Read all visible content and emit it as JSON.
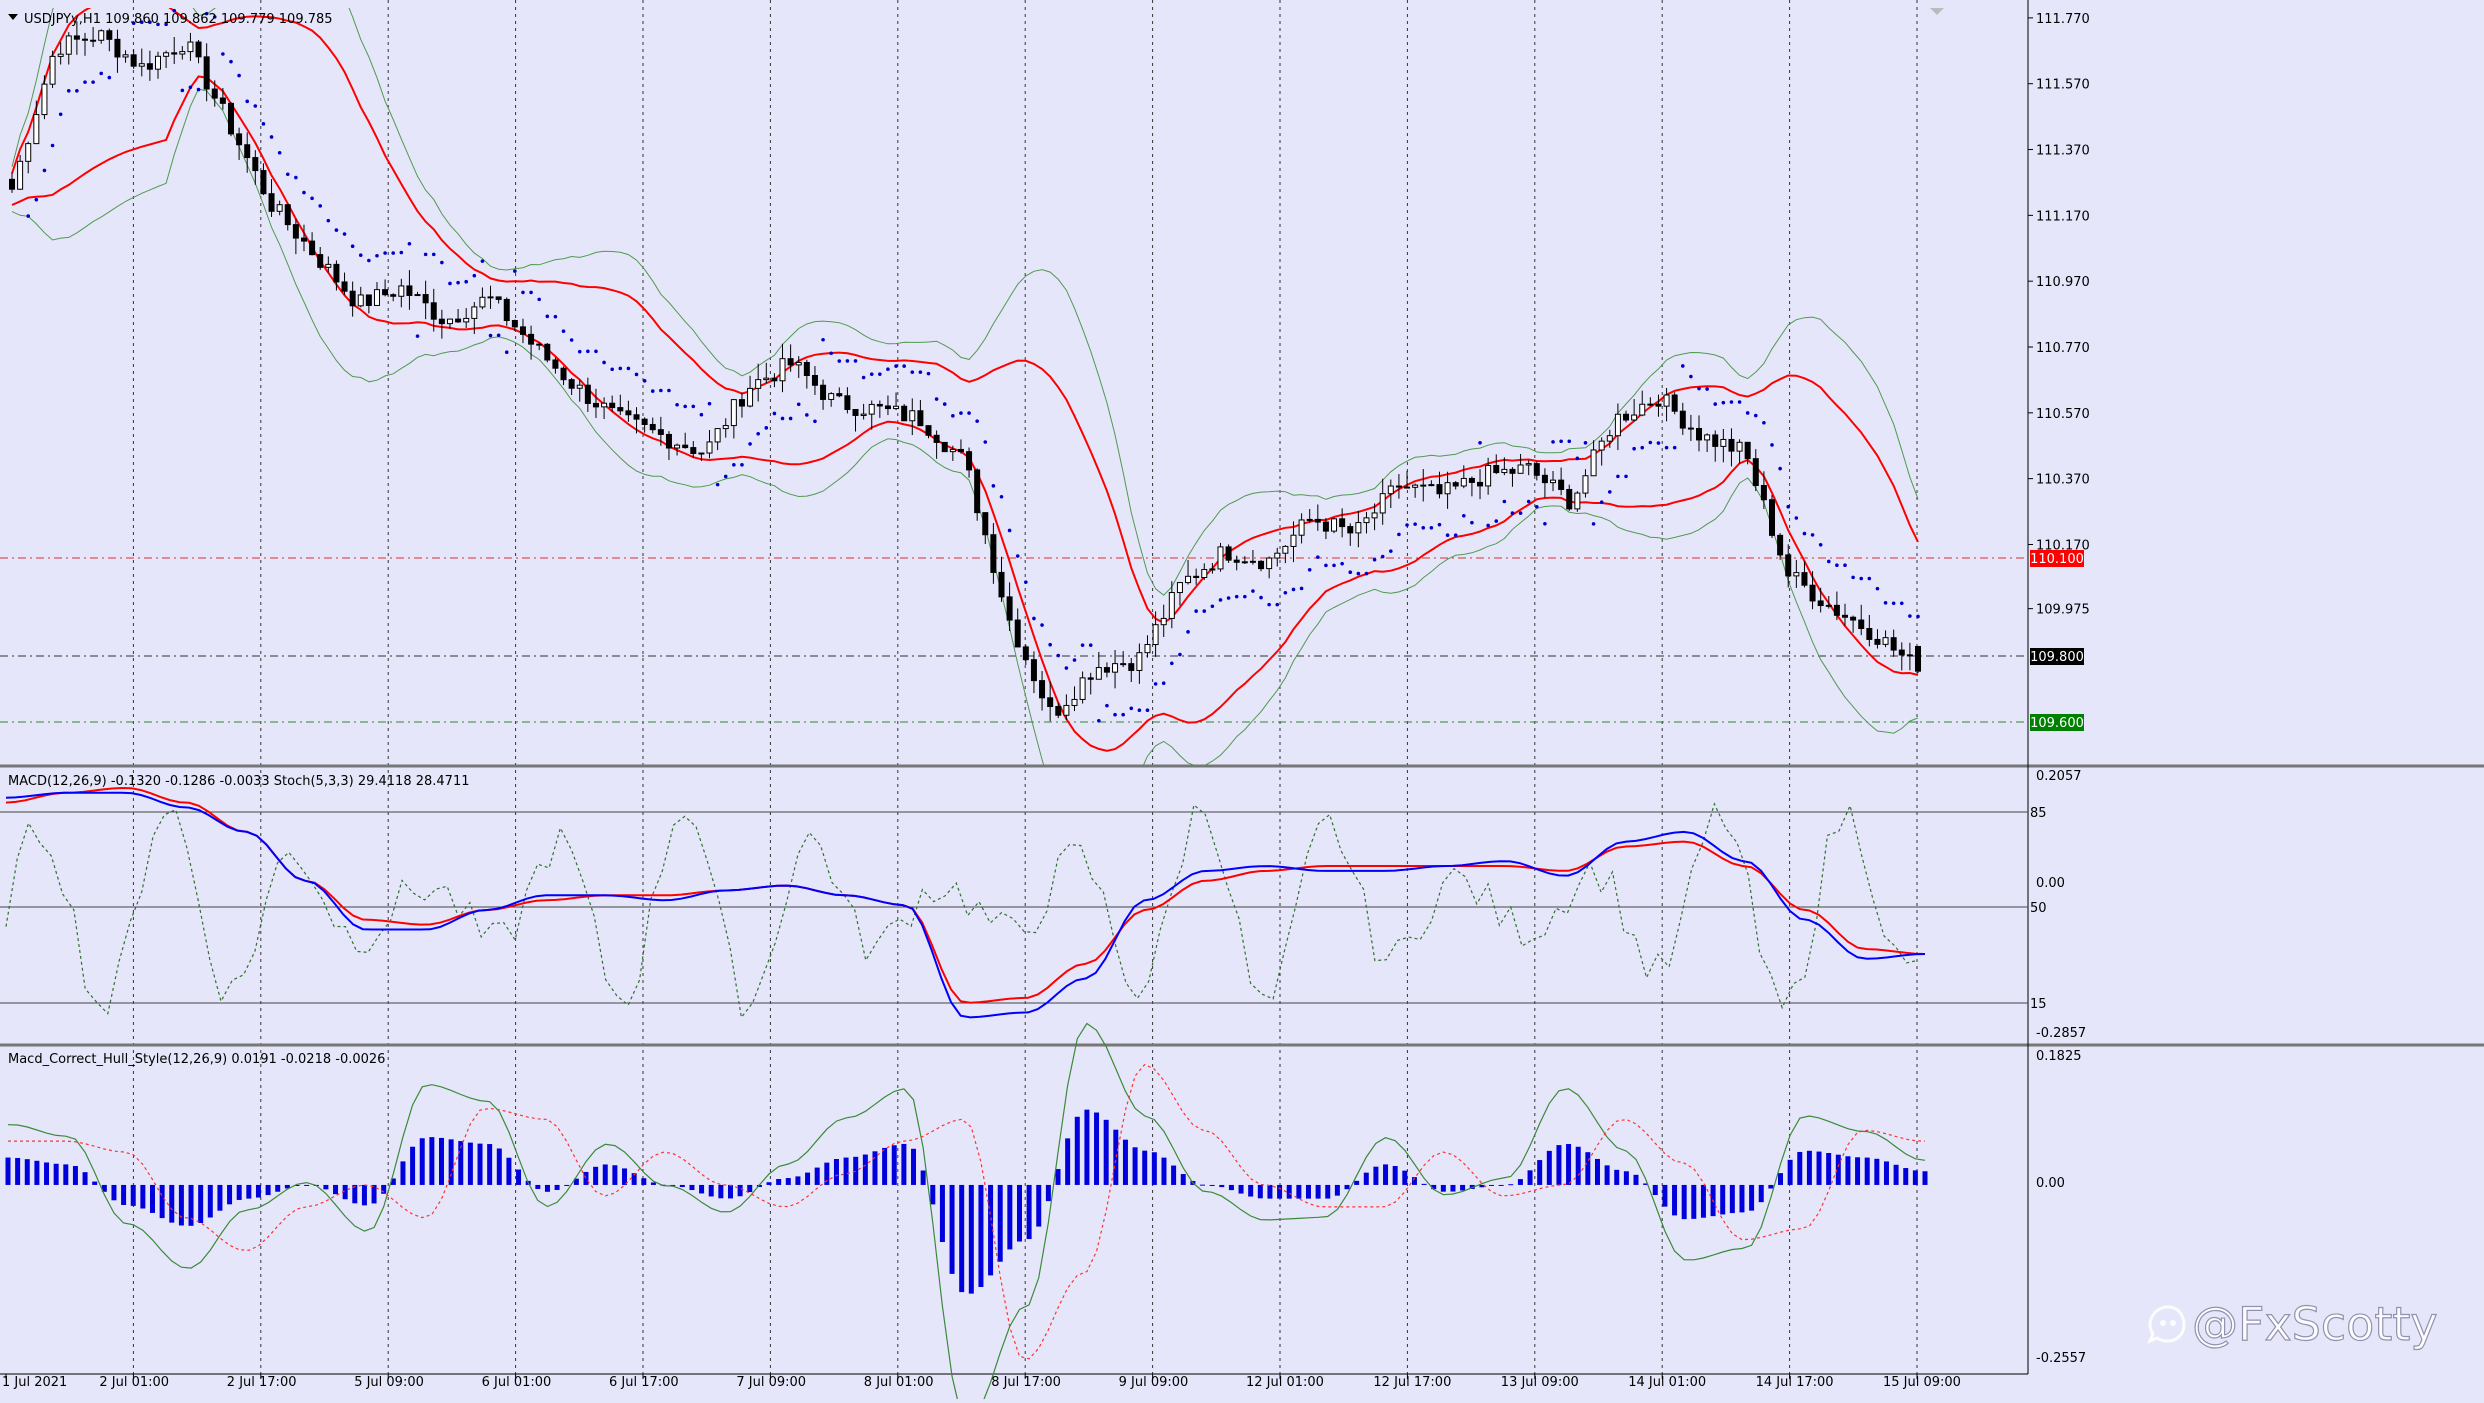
{
  "main": {
    "title": "USDJPYy,H1  109.860 109.862 109.779 109.785",
    "price_levels": [
      {
        "value": "110.100",
        "color": "#ff0000"
      },
      {
        "value": "109.800",
        "color": "#000000"
      },
      {
        "value": "109.600",
        "color": "#008000"
      }
    ]
  },
  "macd": {
    "title": "MACD(12,26,9) -0.1320 -0.1286 -0.0033  Stoch(5,3,3) 29.4118 28.4711"
  },
  "hull": {
    "title": "Macd_Correct_Hull_Style(12,26,9) 0.0191 -0.0218 -0.0026"
  },
  "watermark": "@FxScotty",
  "colors": {
    "background": "#e6e6fa",
    "bollinger_inner": "#ff0000",
    "bollinger_outer": "#4f9a4f",
    "sar": "#0000cc",
    "macd_main": "#0000ff",
    "macd_signal": "#ff0000",
    "stoch": "#2f6f2f",
    "histogram": "#0000dd"
  },
  "chart_data": [
    {
      "type": "candlestick",
      "symbol": "USDJPYy",
      "timeframe": "H1",
      "ylim": [
        109.5,
        111.8
      ],
      "y_ticks": [
        "111.770",
        "111.570",
        "111.370",
        "111.170",
        "110.970",
        "110.770",
        "110.570",
        "110.370",
        "110.170",
        "109.975"
      ],
      "x_ticks": [
        "1 Jul 2021",
        "2 Jul 01:00",
        "2 Jul 17:00",
        "5 Jul 09:00",
        "6 Jul 01:00",
        "6 Jul 17:00",
        "7 Jul 09:00",
        "8 Jul 01:00",
        "8 Jul 17:00",
        "9 Jul 09:00",
        "12 Jul 01:00",
        "12 Jul 17:00",
        "13 Jul 09:00",
        "14 Jul 01:00",
        "14 Jul 17:00",
        "15 Jul 09:00"
      ],
      "close_path": [
        111.25,
        111.68,
        111.72,
        111.62,
        111.7,
        111.45,
        111.2,
        111.05,
        110.9,
        110.95,
        110.85,
        110.92,
        110.78,
        110.65,
        110.55,
        110.5,
        110.45,
        110.65,
        110.72,
        110.6,
        110.58,
        110.55,
        110.42,
        109.95,
        109.65,
        109.8,
        109.82,
        110.05,
        110.15,
        110.12,
        110.25,
        110.2,
        110.35,
        110.32,
        110.38,
        110.4,
        110.3,
        110.55,
        110.62,
        110.5,
        110.45,
        110.08,
        109.98,
        109.9,
        109.79
      ],
      "last": {
        "open": 109.86,
        "high": 109.862,
        "low": 109.779,
        "close": 109.785
      }
    },
    {
      "type": "line",
      "title": "MACD(12,26,9) + Stoch(5,3,3)",
      "y_ticks": [
        "0.2057",
        "0.00",
        "-0.2857"
      ],
      "stoch_levels": [
        "85",
        "50",
        "15"
      ],
      "series": [
        {
          "name": "MACD",
          "values": [
            0.19,
            0.2,
            0.2,
            0.17,
            0.12,
            0.02,
            -0.08,
            -0.08,
            -0.04,
            -0.01,
            -0.01,
            -0.02,
            0.0,
            0.01,
            -0.01,
            -0.03,
            -0.26,
            -0.25,
            -0.18,
            -0.02,
            0.04,
            0.05,
            0.04,
            0.04,
            0.05,
            0.06,
            0.03,
            0.1,
            0.12,
            0.06,
            -0.06,
            -0.14,
            -0.13
          ]
        },
        {
          "name": "Signal",
          "values": [
            0.18,
            0.2,
            0.21,
            0.18,
            0.12,
            0.02,
            -0.06,
            -0.07,
            -0.04,
            -0.02,
            -0.01,
            -0.01,
            0.0,
            0.01,
            -0.01,
            -0.03,
            -0.23,
            -0.22,
            -0.15,
            -0.04,
            0.02,
            0.04,
            0.05,
            0.05,
            0.05,
            0.05,
            0.04,
            0.09,
            0.1,
            0.05,
            -0.04,
            -0.12,
            -0.13
          ]
        }
      ],
      "stoch_last": [
        29.4118,
        28.4711
      ]
    },
    {
      "type": "bar",
      "title": "Macd_Correct_Hull_Style(12,26,9)",
      "y_ticks": [
        "0.1825",
        "0.00",
        "-0.2557"
      ],
      "values": [
        0.04,
        0.03,
        -0.03,
        -0.06,
        -0.02,
        0.0,
        -0.03,
        0.07,
        0.06,
        -0.01,
        0.03,
        0.0,
        -0.02,
        0.01,
        0.04,
        0.06,
        -0.16,
        -0.08,
        0.11,
        0.05,
        0.0,
        -0.02,
        -0.02,
        0.03,
        -0.01,
        0.0,
        0.06,
        0.02,
        -0.05,
        -0.04,
        0.05,
        0.04,
        0.02
      ],
      "last": [
        0.0191,
        -0.0218,
        -0.0026
      ]
    }
  ]
}
